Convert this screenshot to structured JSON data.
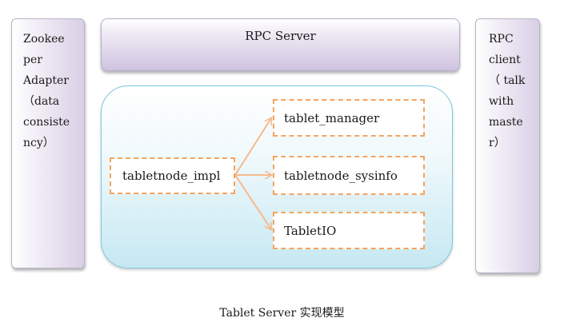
{
  "left_panel": {
    "text": "Zookee\nper\nAdapter\n（data\nconsiste\nncy）"
  },
  "right_panel": {
    "text": "RPC\nclient\n（ talk\nwith\nmaste\nr）"
  },
  "rpc_server": {
    "label": "RPC Server"
  },
  "tablet_server": {
    "impl": "tabletnode_impl",
    "modules": [
      "tablet_manager",
      "tabletnode_sysinfo",
      "TabletIO"
    ]
  },
  "caption": "Tablet Server 实现模型",
  "colors": {
    "dashed_border": "#f4a460",
    "arrow": "#f6b98c",
    "container_border": "#7ec9dc"
  }
}
